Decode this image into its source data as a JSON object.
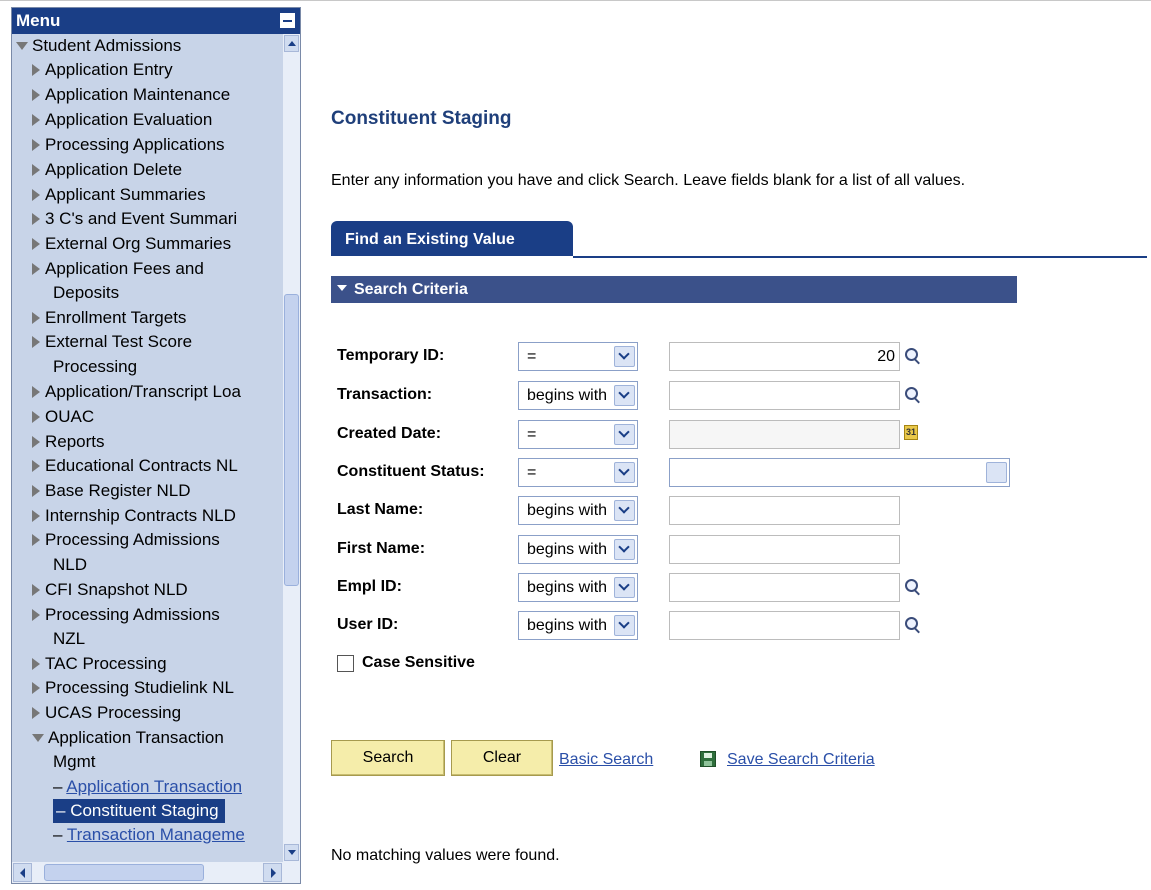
{
  "menu": {
    "title": "Menu",
    "root": "Student Admissions",
    "items": [
      "Application Entry",
      "Application Maintenance",
      "Application Evaluation",
      "Processing Applications",
      "Application Delete",
      "Applicant Summaries",
      "3 C's and Event Summari",
      "External Org Summaries",
      "Application Fees and",
      "Deposits",
      "Enrollment Targets",
      "External Test Score",
      "Processing",
      "Application/Transcript Loa",
      "OUAC",
      "Reports",
      "Educational Contracts NL",
      "Base Register NLD",
      "Internship Contracts NLD",
      "Processing Admissions",
      "NLD",
      "CFI Snapshot NLD",
      "Processing Admissions",
      "NZL",
      "TAC Processing",
      "Processing Studielink NL",
      "UCAS Processing"
    ],
    "expanded_group": "Application Transaction",
    "expanded_group_cont": "Mgmt",
    "subitems": [
      "Application Transaction",
      "Constituent Staging",
      "Transaction Manageme"
    ]
  },
  "page": {
    "title": "Constituent Staging",
    "instructions": "Enter any information you have and click Search. Leave fields blank for a list of all values.",
    "tab_label": "Find an Existing Value",
    "section_label": "Search Criteria"
  },
  "fields": {
    "temporary_id": {
      "label": "Temporary ID:",
      "operator": "=",
      "value": "20"
    },
    "transaction": {
      "label": "Transaction:",
      "operator": "begins with",
      "value": ""
    },
    "created_date": {
      "label": "Created Date:",
      "operator": "=",
      "value": ""
    },
    "constituent_status": {
      "label": "Constituent Status:",
      "operator": "=",
      "value": ""
    },
    "last_name": {
      "label": "Last Name:",
      "operator": "begins with",
      "value": ""
    },
    "first_name": {
      "label": "First Name:",
      "operator": "begins with",
      "value": ""
    },
    "empl_id": {
      "label": "Empl ID:",
      "operator": "begins with",
      "value": ""
    },
    "user_id": {
      "label": "User ID:",
      "operator": "begins with",
      "value": ""
    }
  },
  "case_sensitive_label": "Case Sensitive",
  "buttons": {
    "search": "Search",
    "clear": "Clear"
  },
  "links": {
    "basic_search": "Basic Search",
    "save_search": "Save Search Criteria"
  },
  "status_message": "No matching values were found.",
  "icons": {
    "calendar_glyph": "31"
  }
}
